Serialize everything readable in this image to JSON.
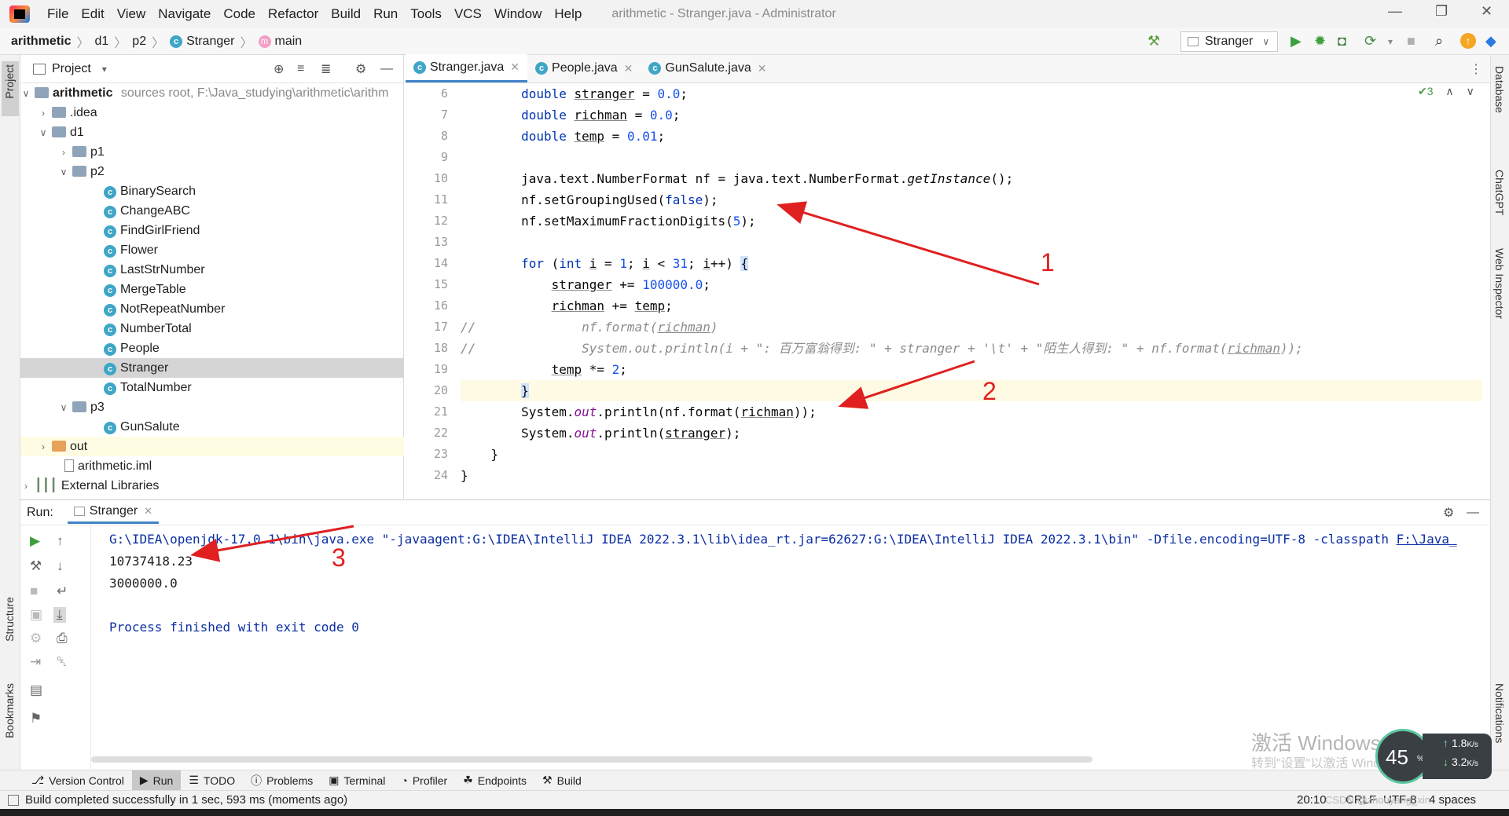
{
  "menu": [
    "File",
    "Edit",
    "View",
    "Navigate",
    "Code",
    "Refactor",
    "Build",
    "Run",
    "Tools",
    "VCS",
    "Window",
    "Help"
  ],
  "window_title": "arithmetic - Stranger.java - Administrator",
  "breadcrumb": {
    "project": "arithmetic",
    "c1": "d1",
    "c2": "p2",
    "c3": "Stranger",
    "c4": "main"
  },
  "run_config": "Stranger",
  "project_panel": {
    "title": "Project",
    "root_name": "arithmetic",
    "root_path": "sources root,  F:\\Java_studying\\arithmetic\\arithm",
    "idea": ".idea",
    "d1": "d1",
    "p1": "p1",
    "p2": "p2",
    "classes": [
      "BinarySearch",
      "ChangeABC",
      "FindGirlFriend",
      "Flower",
      "LastStrNumber",
      "MergeTable",
      "NotRepeatNumber",
      "NumberTotal",
      "People",
      "Stranger",
      "TotalNumber"
    ],
    "p3": "p3",
    "gunsalute": "GunSalute",
    "out": "out",
    "iml": "arithmetic.iml",
    "extlib": "External Libraries"
  },
  "tabs": [
    "Stranger.java",
    "People.java",
    "GunSalute.java"
  ],
  "inspection_count": "3",
  "line_numbers": [
    "6",
    "7",
    "8",
    "9",
    "10",
    "11",
    "12",
    "13",
    "14",
    "15",
    "16",
    "17",
    "18",
    "19",
    "20",
    "21",
    "22",
    "23",
    "24"
  ],
  "run": {
    "label": "Run:",
    "tab": "Stranger",
    "console": [
      "G:\\IDEA\\openjdk-17.0.1\\bin\\java.exe \"-javaagent:G:\\IDEA\\IntelliJ IDEA 2022.3.1\\lib\\idea_rt.jar=62627:G:\\IDEA\\IntelliJ IDEA 2022.3.1\\bin\" -Dfile.encoding=UTF-8 -classpath ",
      "10737418.23",
      "3000000.0",
      "",
      "Process finished with exit code 0"
    ],
    "classpath_link": "F:\\Java_"
  },
  "annotations": [
    "1",
    "2",
    "3"
  ],
  "tool_windows": [
    "Version Control",
    "Run",
    "TODO",
    "Problems",
    "Terminal",
    "Profiler",
    "Endpoints",
    "Build"
  ],
  "status": {
    "message": "Build completed successfully in 1 sec, 593 ms (moments ago)",
    "position": "20:10",
    "line_sep": "CRLF",
    "encoding": "UTF-8",
    "indent": "4 spaces"
  },
  "side_labels": {
    "left_top": "Project",
    "left_structure": "Structure",
    "left_bookmarks": "Bookmarks",
    "right_database": "Database",
    "right_chatgpt": "ChatGPT",
    "right_web": "Web Inspector",
    "right_notif": "Notifications"
  },
  "overlay": {
    "watermark": "激活 Windows",
    "watermark_sub": "转到\"设置\"以激活 Windows。",
    "gauge": "45",
    "gauge_unit": "%",
    "up": "1.8",
    "down": "3.2",
    "speed_unit": "K/s",
    "csdn": "CSDN @zhouyang_xin"
  },
  "colors": {
    "accent": "#4083c9",
    "keyword": "#0033b3",
    "number": "#1750eb",
    "string": "#067d17",
    "annotation": "#e02020"
  }
}
